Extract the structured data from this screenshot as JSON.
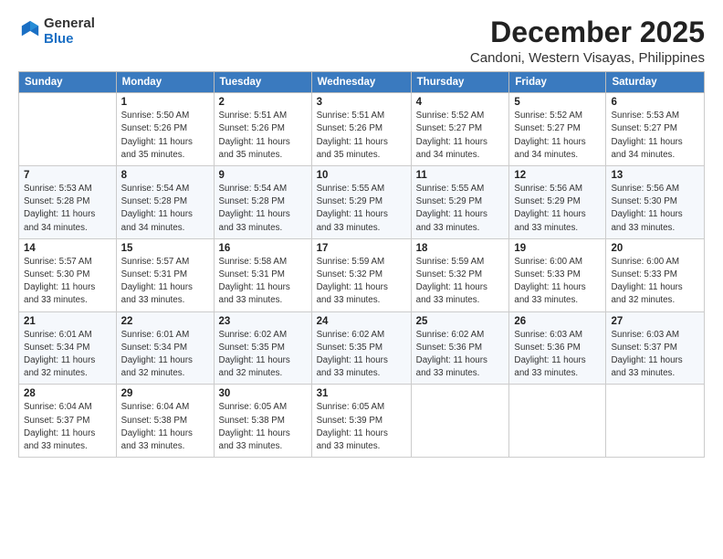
{
  "header": {
    "logo_general": "General",
    "logo_blue": "Blue",
    "month": "December 2025",
    "location": "Candoni, Western Visayas, Philippines"
  },
  "weekdays": [
    "Sunday",
    "Monday",
    "Tuesday",
    "Wednesday",
    "Thursday",
    "Friday",
    "Saturday"
  ],
  "weeks": [
    [
      {
        "day": null,
        "text": null
      },
      {
        "day": "1",
        "text": "Sunrise: 5:50 AM\nSunset: 5:26 PM\nDaylight: 11 hours\nand 35 minutes."
      },
      {
        "day": "2",
        "text": "Sunrise: 5:51 AM\nSunset: 5:26 PM\nDaylight: 11 hours\nand 35 minutes."
      },
      {
        "day": "3",
        "text": "Sunrise: 5:51 AM\nSunset: 5:26 PM\nDaylight: 11 hours\nand 35 minutes."
      },
      {
        "day": "4",
        "text": "Sunrise: 5:52 AM\nSunset: 5:27 PM\nDaylight: 11 hours\nand 34 minutes."
      },
      {
        "day": "5",
        "text": "Sunrise: 5:52 AM\nSunset: 5:27 PM\nDaylight: 11 hours\nand 34 minutes."
      },
      {
        "day": "6",
        "text": "Sunrise: 5:53 AM\nSunset: 5:27 PM\nDaylight: 11 hours\nand 34 minutes."
      }
    ],
    [
      {
        "day": "7",
        "text": "Sunrise: 5:53 AM\nSunset: 5:28 PM\nDaylight: 11 hours\nand 34 minutes."
      },
      {
        "day": "8",
        "text": "Sunrise: 5:54 AM\nSunset: 5:28 PM\nDaylight: 11 hours\nand 34 minutes."
      },
      {
        "day": "9",
        "text": "Sunrise: 5:54 AM\nSunset: 5:28 PM\nDaylight: 11 hours\nand 33 minutes."
      },
      {
        "day": "10",
        "text": "Sunrise: 5:55 AM\nSunset: 5:29 PM\nDaylight: 11 hours\nand 33 minutes."
      },
      {
        "day": "11",
        "text": "Sunrise: 5:55 AM\nSunset: 5:29 PM\nDaylight: 11 hours\nand 33 minutes."
      },
      {
        "day": "12",
        "text": "Sunrise: 5:56 AM\nSunset: 5:29 PM\nDaylight: 11 hours\nand 33 minutes."
      },
      {
        "day": "13",
        "text": "Sunrise: 5:56 AM\nSunset: 5:30 PM\nDaylight: 11 hours\nand 33 minutes."
      }
    ],
    [
      {
        "day": "14",
        "text": "Sunrise: 5:57 AM\nSunset: 5:30 PM\nDaylight: 11 hours\nand 33 minutes."
      },
      {
        "day": "15",
        "text": "Sunrise: 5:57 AM\nSunset: 5:31 PM\nDaylight: 11 hours\nand 33 minutes."
      },
      {
        "day": "16",
        "text": "Sunrise: 5:58 AM\nSunset: 5:31 PM\nDaylight: 11 hours\nand 33 minutes."
      },
      {
        "day": "17",
        "text": "Sunrise: 5:59 AM\nSunset: 5:32 PM\nDaylight: 11 hours\nand 33 minutes."
      },
      {
        "day": "18",
        "text": "Sunrise: 5:59 AM\nSunset: 5:32 PM\nDaylight: 11 hours\nand 33 minutes."
      },
      {
        "day": "19",
        "text": "Sunrise: 6:00 AM\nSunset: 5:33 PM\nDaylight: 11 hours\nand 33 minutes."
      },
      {
        "day": "20",
        "text": "Sunrise: 6:00 AM\nSunset: 5:33 PM\nDaylight: 11 hours\nand 32 minutes."
      }
    ],
    [
      {
        "day": "21",
        "text": "Sunrise: 6:01 AM\nSunset: 5:34 PM\nDaylight: 11 hours\nand 32 minutes."
      },
      {
        "day": "22",
        "text": "Sunrise: 6:01 AM\nSunset: 5:34 PM\nDaylight: 11 hours\nand 32 minutes."
      },
      {
        "day": "23",
        "text": "Sunrise: 6:02 AM\nSunset: 5:35 PM\nDaylight: 11 hours\nand 32 minutes."
      },
      {
        "day": "24",
        "text": "Sunrise: 6:02 AM\nSunset: 5:35 PM\nDaylight: 11 hours\nand 33 minutes."
      },
      {
        "day": "25",
        "text": "Sunrise: 6:02 AM\nSunset: 5:36 PM\nDaylight: 11 hours\nand 33 minutes."
      },
      {
        "day": "26",
        "text": "Sunrise: 6:03 AM\nSunset: 5:36 PM\nDaylight: 11 hours\nand 33 minutes."
      },
      {
        "day": "27",
        "text": "Sunrise: 6:03 AM\nSunset: 5:37 PM\nDaylight: 11 hours\nand 33 minutes."
      }
    ],
    [
      {
        "day": "28",
        "text": "Sunrise: 6:04 AM\nSunset: 5:37 PM\nDaylight: 11 hours\nand 33 minutes."
      },
      {
        "day": "29",
        "text": "Sunrise: 6:04 AM\nSunset: 5:38 PM\nDaylight: 11 hours\nand 33 minutes."
      },
      {
        "day": "30",
        "text": "Sunrise: 6:05 AM\nSunset: 5:38 PM\nDaylight: 11 hours\nand 33 minutes."
      },
      {
        "day": "31",
        "text": "Sunrise: 6:05 AM\nSunset: 5:39 PM\nDaylight: 11 hours\nand 33 minutes."
      },
      {
        "day": null,
        "text": null
      },
      {
        "day": null,
        "text": null
      },
      {
        "day": null,
        "text": null
      }
    ]
  ]
}
